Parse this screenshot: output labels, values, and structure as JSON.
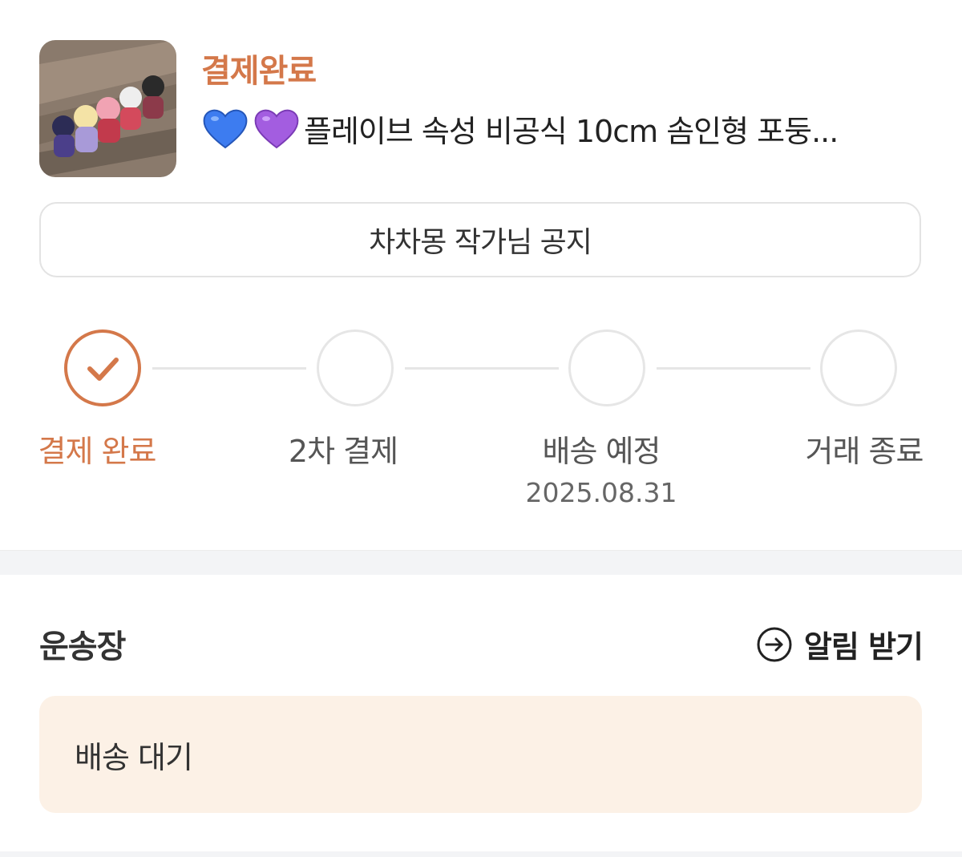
{
  "order": {
    "status": "결제완료",
    "product_title": "플레이브 속성 비공식 10cm 솜인형 포둥...",
    "title_icons": [
      "blue-heart-emoji",
      "purple-heart-emoji"
    ]
  },
  "notice_button": {
    "label": "차차몽 작가님 공지"
  },
  "progress": {
    "current_step": 1,
    "steps": [
      {
        "label": "결제 완료",
        "date": "",
        "done": true
      },
      {
        "label": "2차 결제",
        "date": "",
        "done": false
      },
      {
        "label": "배송 예정",
        "date": "2025.08.31",
        "done": false
      },
      {
        "label": "거래 종료",
        "date": "",
        "done": false
      }
    ]
  },
  "waybill": {
    "title": "운송장",
    "notify_label": "알림 받기",
    "notify_icon": "arrow-right-circle-icon",
    "shipping_status": "배송 대기"
  },
  "colors": {
    "accent": "#d4784a",
    "status_box_bg": "#fcf1e6",
    "inactive": "#e6e6e6",
    "divider": "#f3f4f6"
  }
}
